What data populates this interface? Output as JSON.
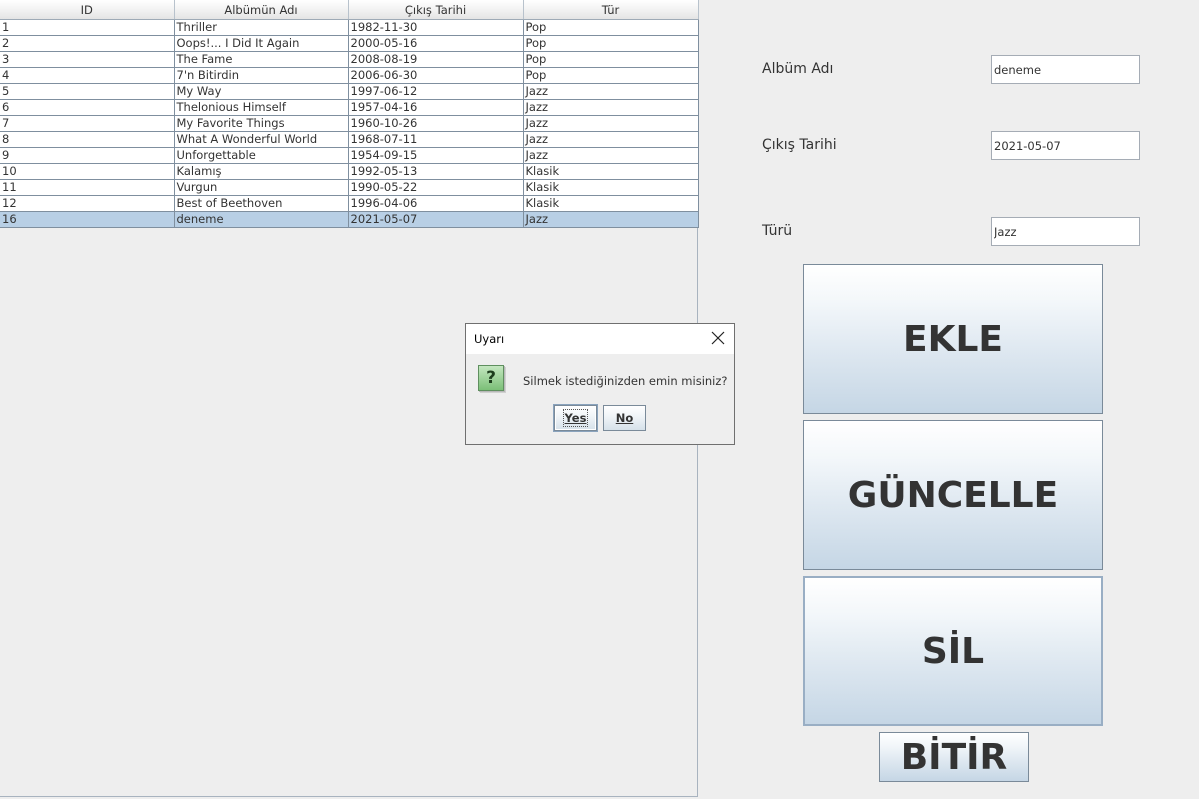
{
  "table": {
    "columns": [
      "ID",
      "Albümün Adı",
      "Çıkış Tarihi",
      "Tür"
    ],
    "rows": [
      [
        "1",
        "Thriller",
        "1982-11-30",
        "Pop"
      ],
      [
        "2",
        "Oops!... I Did It Again",
        "2000-05-16",
        "Pop"
      ],
      [
        "3",
        "The Fame",
        "2008-08-19",
        "Pop"
      ],
      [
        "4",
        "7'n Bitirdin",
        "2006-06-30",
        "Pop"
      ],
      [
        "5",
        "My Way",
        "1997-06-12",
        "Jazz"
      ],
      [
        "6",
        "Thelonious Himself",
        "1957-04-16",
        "Jazz"
      ],
      [
        "7",
        "My Favorite Things",
        "1960-10-26",
        "Jazz"
      ],
      [
        "8",
        "What A Wonderful World",
        "1968-07-11",
        "Jazz"
      ],
      [
        "9",
        "Unforgettable",
        "1954-09-15",
        "Jazz"
      ],
      [
        "10",
        "Kalamış",
        "1992-05-13",
        "Klasik"
      ],
      [
        "11",
        "Vurgun",
        "1990-05-22",
        "Klasik"
      ],
      [
        "12",
        "Best of Beethoven",
        "1996-04-06",
        "Klasik"
      ],
      [
        "16",
        "deneme",
        "2021-05-07",
        "Jazz"
      ]
    ],
    "selected_row_index": 12
  },
  "form": {
    "album_label": "Albüm Adı",
    "album_value": "deneme",
    "date_label": "Çıkış Tarihi",
    "date_value": "2021-05-07",
    "genre_label": "Türü",
    "genre_value": "Jazz"
  },
  "buttons": {
    "add": "EKLE",
    "update": "GÜNCELLE",
    "delete": "SİL",
    "finish": "BİTİR"
  },
  "dialog": {
    "title": "Uyarı",
    "message": "Silmek istediğinizden emin misiniz?",
    "icon": "question-icon",
    "icon_glyph": "?",
    "yes": "Yes",
    "no": "No"
  },
  "colors": {
    "selection": "#b8cfe5",
    "icon_green": "#7bbf77"
  }
}
